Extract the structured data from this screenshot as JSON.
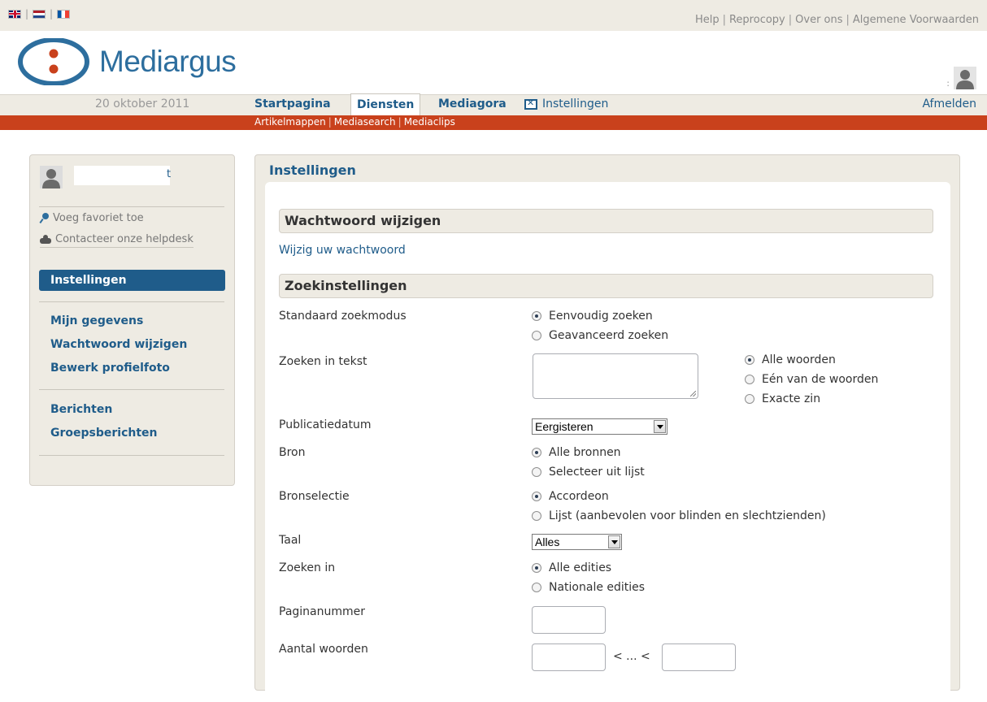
{
  "top_links": [
    "Help",
    "Reprocopy",
    "Over ons",
    "Algemene Voorwaarden"
  ],
  "logo_text": "Mediargus",
  "nav": {
    "date": "20 oktober 2011",
    "items": [
      "Startpagina",
      "Diensten",
      "Mediagora"
    ],
    "settings": "Instellingen",
    "logout": "Afmelden"
  },
  "subnav": [
    "Artikelmappen",
    "Mediasearch",
    "Mediaclips"
  ],
  "sidebar": {
    "user_name": "t",
    "links": [
      "Voeg favoriet toe",
      "Contacteer onze helpdesk"
    ],
    "active": "Instellingen",
    "group1": [
      "Mijn gegevens",
      "Wachtwoord wijzigen",
      "Bewerk profielfoto"
    ],
    "group2": [
      "Berichten",
      "Groepsberichten"
    ]
  },
  "main": {
    "title": "Instellingen",
    "password_section": "Wachtwoord wijzigen",
    "password_link": "Wijzig uw wachtwoord",
    "search_section": "Zoekinstellingen",
    "fields": {
      "mode": {
        "label": "Standaard zoekmodus",
        "options": [
          "Eenvoudig zoeken",
          "Geavanceerd zoeken"
        ],
        "selected": "Eenvoudig zoeken"
      },
      "text": {
        "label": "Zoeken in tekst",
        "options": [
          "Alle woorden",
          "Eén van de woorden",
          "Exacte zin"
        ],
        "selected": "Alle woorden",
        "value": ""
      },
      "date": {
        "label": "Publicatiedatum",
        "value": "Eergisteren"
      },
      "source": {
        "label": "Bron",
        "options": [
          "Alle bronnen",
          "Selecteer uit lijst"
        ],
        "selected": "Alle bronnen"
      },
      "source_sel": {
        "label": "Bronselectie",
        "options": [
          "Accordeon",
          "Lijst (aanbevolen voor blinden en slechtzienden)"
        ],
        "selected": "Accordeon"
      },
      "lang": {
        "label": "Taal",
        "value": "Alles"
      },
      "edition": {
        "label": "Zoeken in",
        "options": [
          "Alle edities",
          "Nationale edities"
        ],
        "selected": "Alle edities"
      },
      "page": {
        "label": "Paginanummer",
        "value": ""
      },
      "words": {
        "label": "Aantal woorden",
        "between": "< ... <",
        "min": "",
        "max": ""
      }
    }
  },
  "colors": {
    "brand_blue": "#1f5c8a",
    "subnav_red": "#c9411c",
    "panel_beige": "#eeebe3"
  }
}
